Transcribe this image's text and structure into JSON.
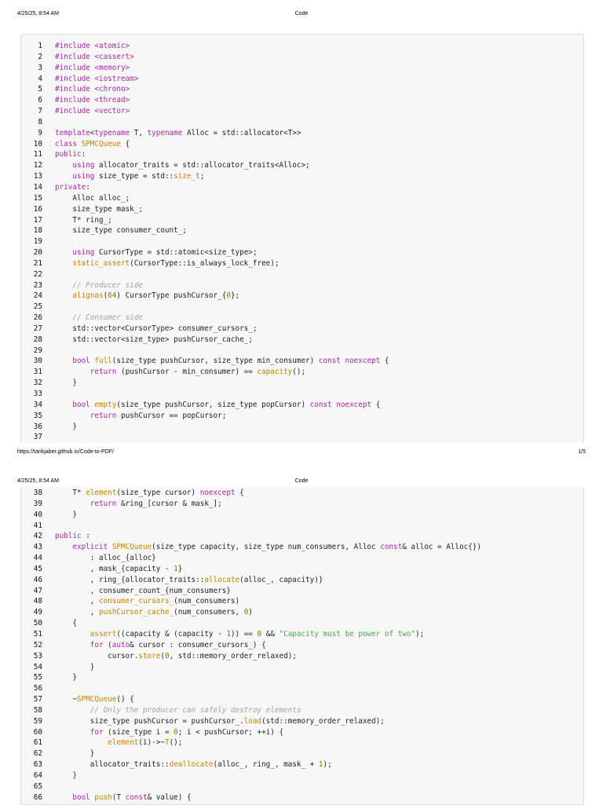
{
  "page1": {
    "header": {
      "date": "4/25/25, 8:54 AM",
      "title": "Code"
    },
    "footer": {
      "url": "https://tarikjaber.github.io/Code-to-PDF/",
      "page": "1/5"
    }
  },
  "page2": {
    "header": {
      "date": "4/25/25, 8:54 AM",
      "title": "Code"
    }
  },
  "code_page1": [
    {
      "n": "1",
      "t": [
        [
          "p",
          "#include <atomic>"
        ]
      ]
    },
    {
      "n": "2",
      "t": [
        [
          "p",
          "#include <cassert>"
        ]
      ]
    },
    {
      "n": "3",
      "t": [
        [
          "p",
          "#include <memory>"
        ]
      ]
    },
    {
      "n": "4",
      "t": [
        [
          "p",
          "#include <iostream>"
        ]
      ]
    },
    {
      "n": "5",
      "t": [
        [
          "p",
          "#include <chrono>"
        ]
      ]
    },
    {
      "n": "6",
      "t": [
        [
          "p",
          "#include <thread>"
        ]
      ]
    },
    {
      "n": "7",
      "t": [
        [
          "p",
          "#include <vector>"
        ]
      ]
    },
    {
      "n": "8",
      "t": []
    },
    {
      "n": "9",
      "t": [
        [
          "k",
          "template"
        ],
        [
          "",
          "<"
        ],
        [
          "k",
          "typename"
        ],
        [
          "",
          " T, "
        ],
        [
          "k",
          "typename"
        ],
        [
          "",
          " Alloc = std::allocator<T>>"
        ]
      ]
    },
    {
      "n": "10",
      "t": [
        [
          "k",
          "class"
        ],
        [
          "",
          " "
        ],
        [
          "f",
          "SPMCQueue"
        ],
        [
          "",
          " {"
        ]
      ]
    },
    {
      "n": "11",
      "t": [
        [
          "k",
          "public"
        ],
        [
          "",
          ":"
        ]
      ]
    },
    {
      "n": "12",
      "t": [
        [
          "",
          "    "
        ],
        [
          "k",
          "using"
        ],
        [
          "",
          " allocator_traits = std::allocator_traits<Alloc>;"
        ]
      ]
    },
    {
      "n": "13",
      "t": [
        [
          "",
          "    "
        ],
        [
          "k",
          "using"
        ],
        [
          "",
          " size_type = std::"
        ],
        [
          "f",
          "size_t"
        ],
        [
          "",
          ";"
        ]
      ]
    },
    {
      "n": "14",
      "t": [
        [
          "k",
          "private"
        ],
        [
          "",
          ":"
        ]
      ]
    },
    {
      "n": "15",
      "t": [
        [
          "",
          "    Alloc alloc_;"
        ]
      ]
    },
    {
      "n": "16",
      "t": [
        [
          "",
          "    size_type mask_;"
        ]
      ]
    },
    {
      "n": "17",
      "t": [
        [
          "",
          "    T* ring_;"
        ]
      ]
    },
    {
      "n": "18",
      "t": [
        [
          "",
          "    size_type consumer_count_;"
        ]
      ]
    },
    {
      "n": "19",
      "t": []
    },
    {
      "n": "20",
      "t": [
        [
          "",
          "    "
        ],
        [
          "k",
          "using"
        ],
        [
          "",
          " CursorType = std::atomic<size_type>;"
        ]
      ]
    },
    {
      "n": "21",
      "t": [
        [
          "",
          "    "
        ],
        [
          "f",
          "static_assert"
        ],
        [
          "",
          "(CursorType::is_always_lock_free);"
        ]
      ]
    },
    {
      "n": "22",
      "t": []
    },
    {
      "n": "23",
      "t": [
        [
          "",
          "    "
        ],
        [
          "c",
          "// Producer side"
        ]
      ]
    },
    {
      "n": "24",
      "t": [
        [
          "",
          "    "
        ],
        [
          "f",
          "alignas"
        ],
        [
          "",
          "("
        ],
        [
          "n",
          "64"
        ],
        [
          "",
          ") CursorType pushCursor_{"
        ],
        [
          "n",
          "0"
        ],
        [
          "",
          "};"
        ]
      ]
    },
    {
      "n": "25",
      "t": []
    },
    {
      "n": "26",
      "t": [
        [
          "",
          "    "
        ],
        [
          "c",
          "// Consumer side"
        ]
      ]
    },
    {
      "n": "27",
      "t": [
        [
          "",
          "    std::vector<CursorType> consumer_cursors_;"
        ]
      ]
    },
    {
      "n": "28",
      "t": [
        [
          "",
          "    std::vector<size_type> pushCursor_cache_;"
        ]
      ]
    },
    {
      "n": "29",
      "t": []
    },
    {
      "n": "30",
      "t": [
        [
          "",
          "    "
        ],
        [
          "k",
          "bool"
        ],
        [
          "",
          " "
        ],
        [
          "f",
          "full"
        ],
        [
          "",
          "(size_type pushCursor, size_type min_consumer) "
        ],
        [
          "k",
          "const"
        ],
        [
          "",
          " "
        ],
        [
          "k",
          "noexcept"
        ],
        [
          "",
          " {"
        ]
      ]
    },
    {
      "n": "31",
      "t": [
        [
          "",
          "        "
        ],
        [
          "k",
          "return"
        ],
        [
          "",
          " (pushCursor - min_consumer) == "
        ],
        [
          "f",
          "capacity"
        ],
        [
          "",
          "();"
        ]
      ]
    },
    {
      "n": "32",
      "t": [
        [
          "",
          "    }"
        ]
      ]
    },
    {
      "n": "33",
      "t": []
    },
    {
      "n": "34",
      "t": [
        [
          "",
          "    "
        ],
        [
          "k",
          "bool"
        ],
        [
          "",
          " "
        ],
        [
          "f",
          "empty"
        ],
        [
          "",
          "(size_type pushCursor, size_type popCursor) "
        ],
        [
          "k",
          "const"
        ],
        [
          "",
          " "
        ],
        [
          "k",
          "noexcept"
        ],
        [
          "",
          " {"
        ]
      ]
    },
    {
      "n": "35",
      "t": [
        [
          "",
          "        "
        ],
        [
          "k",
          "return"
        ],
        [
          "",
          " pushCursor == popCursor;"
        ]
      ]
    },
    {
      "n": "36",
      "t": [
        [
          "",
          "    }"
        ]
      ]
    },
    {
      "n": "37",
      "t": []
    }
  ],
  "code_page2": [
    {
      "n": "38",
      "t": [
        [
          "",
          "    T* "
        ],
        [
          "f",
          "element"
        ],
        [
          "",
          "(size_type cursor) "
        ],
        [
          "k",
          "noexcept"
        ],
        [
          "",
          " {"
        ]
      ]
    },
    {
      "n": "39",
      "t": [
        [
          "",
          "        "
        ],
        [
          "k",
          "return"
        ],
        [
          "",
          " &ring_[cursor & mask_];"
        ]
      ]
    },
    {
      "n": "40",
      "t": [
        [
          "",
          "    }"
        ]
      ]
    },
    {
      "n": "41",
      "t": []
    },
    {
      "n": "42",
      "t": [
        [
          "k",
          "public"
        ],
        [
          "",
          " :"
        ]
      ]
    },
    {
      "n": "43",
      "t": [
        [
          "",
          "    "
        ],
        [
          "k",
          "explicit"
        ],
        [
          "",
          " "
        ],
        [
          "f",
          "SPMCQueue"
        ],
        [
          "",
          "(size_type capacity, size_type num_consumers, Alloc "
        ],
        [
          "k",
          "const"
        ],
        [
          "",
          "& alloc = Alloc{})"
        ]
      ]
    },
    {
      "n": "44",
      "t": [
        [
          "",
          "        : alloc_{alloc}"
        ]
      ]
    },
    {
      "n": "45",
      "t": [
        [
          "",
          "        , mask_{capacity - "
        ],
        [
          "n",
          "1"
        ],
        [
          "",
          "}"
        ]
      ]
    },
    {
      "n": "46",
      "t": [
        [
          "",
          "        , ring_{allocator_traits::"
        ],
        [
          "f",
          "allocate"
        ],
        [
          "",
          "(alloc_, capacity)}"
        ]
      ]
    },
    {
      "n": "47",
      "t": [
        [
          "",
          "        , consumer_count_{num_consumers}"
        ]
      ]
    },
    {
      "n": "48",
      "t": [
        [
          "",
          "        , "
        ],
        [
          "f",
          "consumer_cursors_"
        ],
        [
          "",
          "(num_consumers)"
        ]
      ]
    },
    {
      "n": "49",
      "t": [
        [
          "",
          "        , "
        ],
        [
          "f",
          "pushCursor_cache_"
        ],
        [
          "",
          "(num_consumers, "
        ],
        [
          "n",
          "0"
        ],
        [
          "",
          ")"
        ]
      ]
    },
    {
      "n": "50",
      "t": [
        [
          "",
          "    {"
        ]
      ]
    },
    {
      "n": "51",
      "t": [
        [
          "",
          "        "
        ],
        [
          "f",
          "assert"
        ],
        [
          "",
          "((capacity & (capacity - "
        ],
        [
          "n",
          "1"
        ],
        [
          "",
          ")) == "
        ],
        [
          "n",
          "0"
        ],
        [
          "",
          " && "
        ],
        [
          "s",
          "\"Capacity must be power of two\""
        ],
        [
          "",
          ");"
        ]
      ]
    },
    {
      "n": "52",
      "t": [
        [
          "",
          "        "
        ],
        [
          "k",
          "for"
        ],
        [
          "",
          " ("
        ],
        [
          "k",
          "auto"
        ],
        [
          "",
          "& cursor : consumer_cursors_) {"
        ]
      ]
    },
    {
      "n": "53",
      "t": [
        [
          "",
          "            cursor."
        ],
        [
          "f",
          "store"
        ],
        [
          "",
          "("
        ],
        [
          "n",
          "0"
        ],
        [
          "",
          ", std::memory_order_relaxed);"
        ]
      ]
    },
    {
      "n": "54",
      "t": [
        [
          "",
          "        }"
        ]
      ]
    },
    {
      "n": "55",
      "t": [
        [
          "",
          "    }"
        ]
      ]
    },
    {
      "n": "56",
      "t": []
    },
    {
      "n": "57",
      "t": [
        [
          "",
          "    ~"
        ],
        [
          "f",
          "SPMCQueue"
        ],
        [
          "",
          "() {"
        ]
      ]
    },
    {
      "n": "58",
      "t": [
        [
          "",
          "        "
        ],
        [
          "c",
          "// Only the producer can safely destroy elements"
        ]
      ]
    },
    {
      "n": "59",
      "t": [
        [
          "",
          "        size_type pushCursor = pushCursor_."
        ],
        [
          "f",
          "load"
        ],
        [
          "",
          "(std::memory_order_relaxed);"
        ]
      ]
    },
    {
      "n": "60",
      "t": [
        [
          "",
          "        "
        ],
        [
          "k",
          "for"
        ],
        [
          "",
          " (size_type i = "
        ],
        [
          "n",
          "0"
        ],
        [
          "",
          "; i < pushCursor; ++i) {"
        ]
      ]
    },
    {
      "n": "61",
      "t": [
        [
          "",
          "            "
        ],
        [
          "f",
          "element"
        ],
        [
          "",
          "(i)->~"
        ],
        [
          "f",
          "T"
        ],
        [
          "",
          "();"
        ]
      ]
    },
    {
      "n": "62",
      "t": [
        [
          "",
          "        }"
        ]
      ]
    },
    {
      "n": "63",
      "t": [
        [
          "",
          "        allocator_traits::"
        ],
        [
          "f",
          "deallocate"
        ],
        [
          "",
          "(alloc_, ring_, mask_ + "
        ],
        [
          "n",
          "1"
        ],
        [
          "",
          ");"
        ]
      ]
    },
    {
      "n": "64",
      "t": [
        [
          "",
          "    }"
        ]
      ]
    },
    {
      "n": "65",
      "t": []
    },
    {
      "n": "66",
      "t": [
        [
          "",
          "    "
        ],
        [
          "k",
          "bool"
        ],
        [
          "",
          " "
        ],
        [
          "f",
          "push"
        ],
        [
          "",
          "(T "
        ],
        [
          "k",
          "const"
        ],
        [
          "",
          "& value) {"
        ]
      ]
    }
  ],
  "colors": {
    "keyword": "#a626a4",
    "function": "#c18401",
    "comment": "#a0a1a7",
    "string": "#50a14f",
    "number": "#986801",
    "card_background": "#f7f7f7"
  }
}
